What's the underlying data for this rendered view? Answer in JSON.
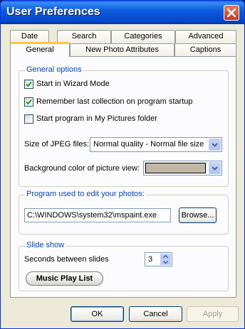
{
  "window": {
    "title": "User Preferences"
  },
  "tabs": {
    "row1": [
      "Date",
      "Search",
      "Categories",
      "Advanced"
    ],
    "row2": [
      "General",
      "New Photo Attributes",
      "Captions"
    ],
    "active": "General"
  },
  "general_options": {
    "title": "General options",
    "checkboxes": [
      {
        "label": "Start in Wizard Mode",
        "checked": true
      },
      {
        "label": "Remember last collection on program startup",
        "checked": true
      },
      {
        "label": "Start program in My Pictures folder",
        "checked": false
      }
    ],
    "jpeg_size_label": "Size of JPEG files:",
    "jpeg_size_value": "Normal quality - Normal file size",
    "bg_color_label": "Background color of picture view:",
    "bg_color_value": "#c0b7a6"
  },
  "editor": {
    "title": "Program used to edit your photos:",
    "path_value": "C:\\WINDOWS\\system32\\mspaint.exe",
    "browse_label": "Browse..."
  },
  "slideshow": {
    "title": "Slide show",
    "seconds_label": "Seconds between slides",
    "seconds_value": "3",
    "music_label": "Music Play List"
  },
  "footer": {
    "ok_label": "OK",
    "cancel_label": "Cancel",
    "apply_label": "Apply",
    "apply_enabled": false
  },
  "colors": {
    "title_bar": "#0a5fe6",
    "group_title": "#0046d5",
    "active_tab_accent": "#ffc83c",
    "close_button": "#c5381a"
  }
}
